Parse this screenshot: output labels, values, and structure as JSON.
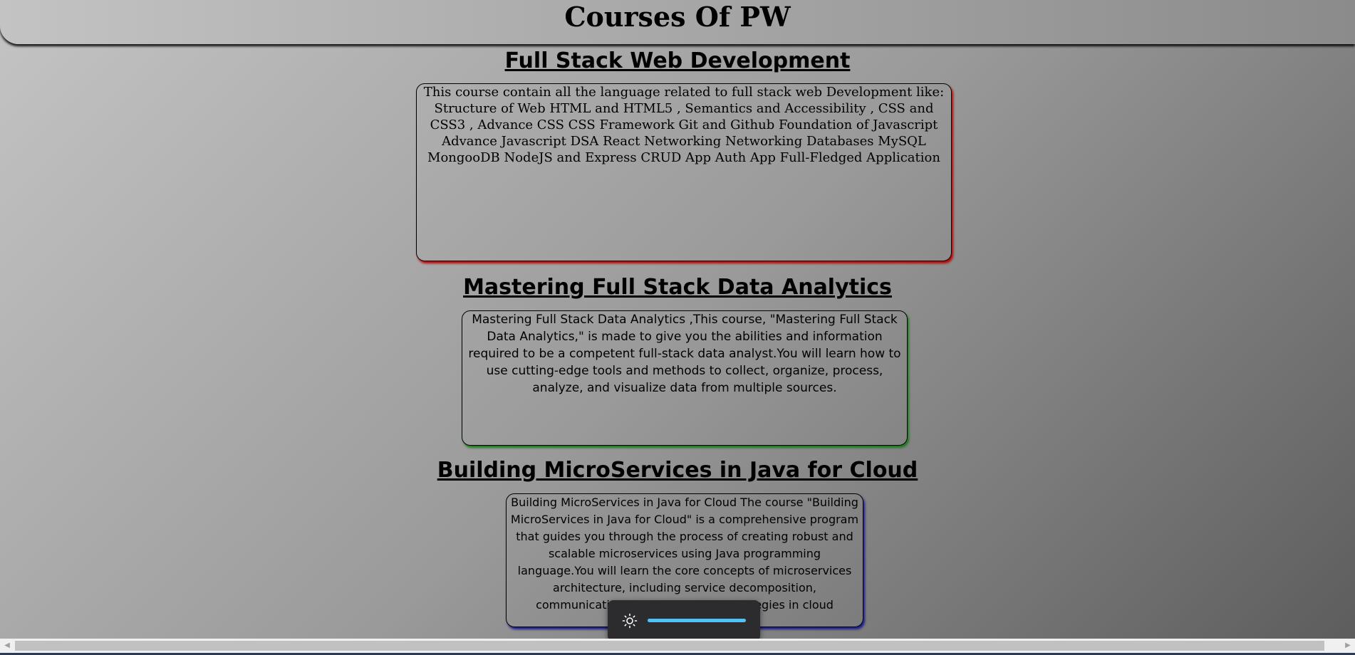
{
  "header": {
    "title": "Courses Of PW"
  },
  "courses": [
    {
      "heading": "Full Stack Web Development",
      "description": "This course contain all the language related to full stack web Development like: Structure of Web HTML and HTML5 , Semantics and Accessibility , CSS and CSS3 , Advance CSS CSS Framework Git and Github Foundation of Javascript Advance Javascript DSA React Networking Networking Databases MySQL MongooDB NodeJS and Express CRUD App Auth App Full-Fledged Application",
      "shadow_color": "#c00000"
    },
    {
      "heading": "Mastering Full Stack Data Analytics",
      "description": "Mastering Full Stack Data Analytics ,This course, \"Mastering Full Stack Data Analytics,\" is made to give you the abilities and information required to be a competent full-stack data analyst.You will learn how to use cutting-edge tools and methods to collect, organize, process, analyze, and visualize data from multiple sources.",
      "shadow_color": "#1a7a1a"
    },
    {
      "heading": "Building MicroServices in Java for Cloud",
      "description": "Building MicroServices in Java for Cloud The course \"Building MicroServices in Java for Cloud\" is a comprehensive program that guides you through the process of creating robust and scalable microservices using Java programming language.You will learn the core concepts of microservices architecture, including service decomposition, communication, and deployment strategies in cloud environments.",
      "shadow_color": "#1a1a90"
    }
  ],
  "brightness_osd": {
    "icon": "sun-icon",
    "level": 1.0,
    "accent_color": "#4fc3f7"
  },
  "scrollbar": {
    "left_arrow": "◀",
    "right_arrow": "▶"
  }
}
